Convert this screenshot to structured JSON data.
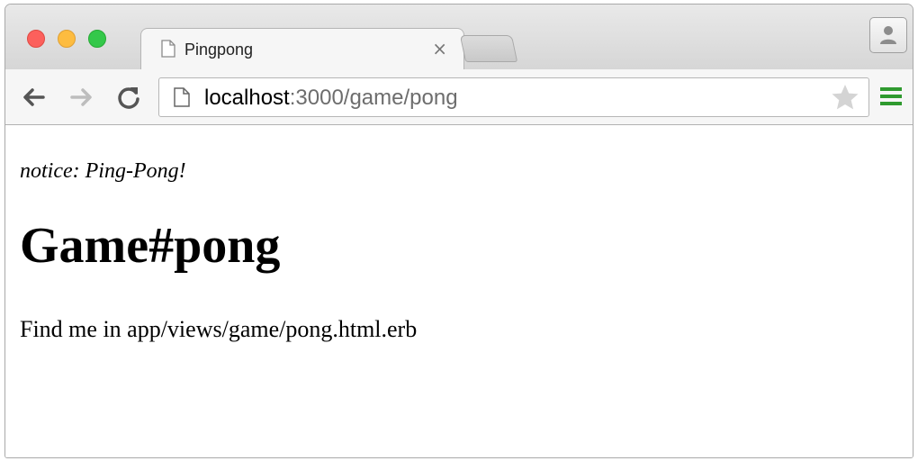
{
  "browser": {
    "tab": {
      "title": "Pingpong",
      "close_label": "×"
    },
    "address_bar": {
      "host": "localhost",
      "path": ":3000/game/pong"
    },
    "icons": {
      "back": "back-arrow-icon",
      "forward": "forward-arrow-icon",
      "reload": "reload-icon",
      "page": "document-icon",
      "bookmark": "star-icon",
      "menu": "hamburger-menu-icon",
      "profile": "person-icon"
    },
    "colors": {
      "close": "#fc605c",
      "minimize": "#fdbc40",
      "maximize": "#34c84a",
      "menu_icon": "#2f9a2f"
    }
  },
  "page": {
    "notice": "notice: Ping-Pong!",
    "heading": "Game#pong",
    "body": "Find me in app/views/game/pong.html.erb"
  }
}
